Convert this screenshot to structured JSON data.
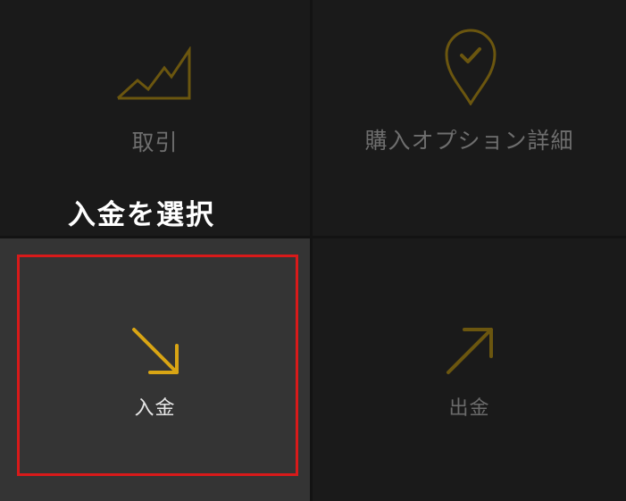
{
  "menu": {
    "trade": {
      "label": "取引",
      "icon": "chart-rising-icon"
    },
    "option_details": {
      "label": "購入オプション詳細",
      "icon": "location-pin-check-icon"
    },
    "deposit": {
      "label": "入金",
      "icon": "arrow-down-right-icon"
    },
    "withdraw": {
      "label": "出金",
      "icon": "arrow-up-right-icon"
    }
  },
  "annotation": {
    "instruction": "入金を選択"
  },
  "colors": {
    "background": "#1a1a1a",
    "selected_tile": "#343434",
    "gold_accent": "#c9960c",
    "dim_gold": "#6b560f",
    "highlight_border": "#d81a1a"
  }
}
